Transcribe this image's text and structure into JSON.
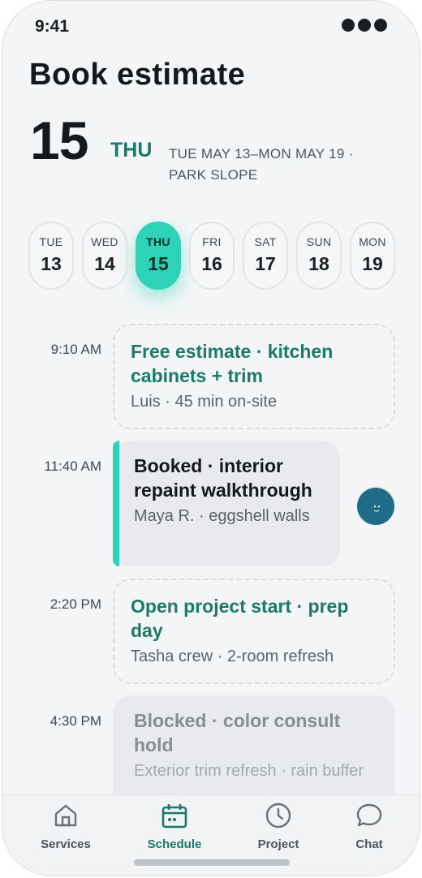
{
  "status": {
    "time": "9:41"
  },
  "header": {
    "title": "Book estimate",
    "day_number": "15",
    "day_of_week": "THU",
    "range_text": "TUE MAY 13–MON MAY 19 · PARK SLOPE"
  },
  "days": [
    {
      "dow": "TUE",
      "num": "13",
      "active": false
    },
    {
      "dow": "WED",
      "num": "14",
      "active": false
    },
    {
      "dow": "THU",
      "num": "15",
      "active": true
    },
    {
      "dow": "FRI",
      "num": "16",
      "active": false
    },
    {
      "dow": "SAT",
      "num": "17",
      "active": false
    },
    {
      "dow": "SUN",
      "num": "18",
      "active": false
    },
    {
      "dow": "MON",
      "num": "19",
      "active": false
    }
  ],
  "slots": [
    {
      "time": "9:10 AM",
      "status": "open",
      "title": "Free estimate · kitchen cabinets + trim",
      "subtitle": "Luis · 45 min on-site"
    },
    {
      "time": "11:40 AM",
      "status": "booked",
      "title": "Booked · interior repaint walkthrough",
      "subtitle": "Maya R. · eggshell walls"
    },
    {
      "time": "2:20 PM",
      "status": "open",
      "title": "Open project start · prep day",
      "subtitle": "Tasha crew · 2-room refresh"
    },
    {
      "time": "4:30 PM",
      "status": "blocked",
      "title": "Blocked · color consult hold",
      "subtitle": "Exterior trim refresh · rain buffer"
    }
  ],
  "tabs": [
    {
      "label": "Services",
      "icon": "home-icon",
      "active": false
    },
    {
      "label": "Schedule",
      "icon": "calendar-icon",
      "active": true
    },
    {
      "label": "Project",
      "icon": "clock-icon",
      "active": false
    },
    {
      "label": "Chat",
      "icon": "chat-bubble-icon",
      "active": false
    }
  ],
  "colors": {
    "accent": "#2ed3b7",
    "accent_text": "#1b7a69",
    "background": "#f3f5f6"
  }
}
